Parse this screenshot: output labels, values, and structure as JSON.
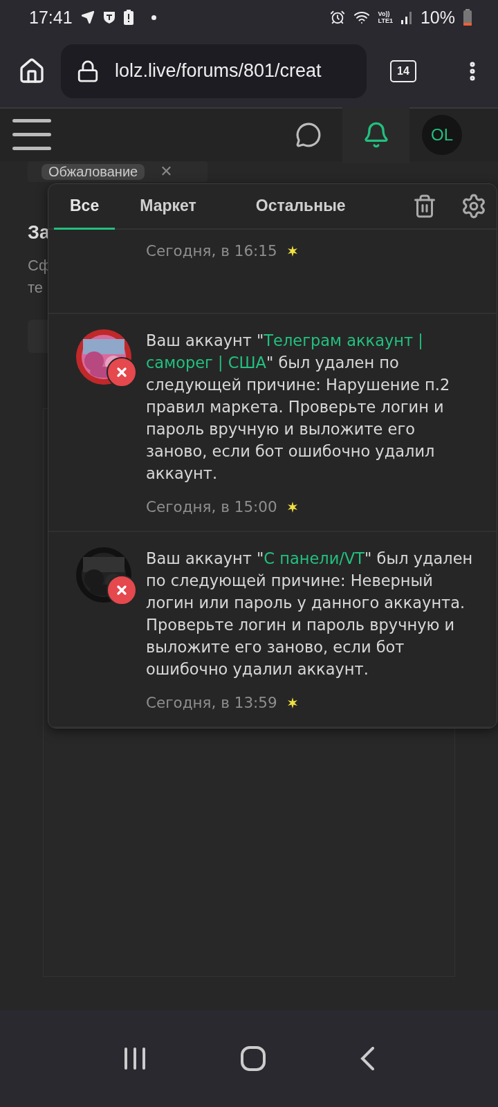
{
  "status_bar": {
    "time": "17:41",
    "network_top": "Vo))",
    "network_bottom": "LTE1",
    "battery": "10%"
  },
  "browser": {
    "url": "lolz.live/forums/801/creat",
    "tab_count": "14"
  },
  "site_header": {
    "avatar_initials": "OL",
    "bell_active": true
  },
  "page": {
    "tag": "Обжалование",
    "tag_remove": "✕",
    "heading": "За",
    "description_lines": [
      "Сф",
      "те"
    ]
  },
  "popup": {
    "tabs": [
      {
        "label": "Все",
        "selected": true
      },
      {
        "label": "Маркет",
        "selected": false
      },
      {
        "label": "Остальные",
        "selected": false
      }
    ],
    "notifications": [
      {
        "time": "Сегодня, в 16:15"
      },
      {
        "kind": "picture",
        "segments": [
          {
            "kind": "plain",
            "text": "Ваш аккаунт \""
          },
          {
            "kind": "link",
            "text": "Телеграм аккаунт |"
          },
          {
            "kind": "link",
            "text": "саморег | США"
          },
          {
            "kind": "plain",
            "text": "\" был удален по следующей причине: Нарушение п.2 правил маркета. Проверьте логин и пароль вручную и выложите его заново, если бот ошибочно удалил аккаунт."
          }
        ],
        "time": "Сегодня, в 15:00"
      },
      {
        "kind": "picture",
        "segments": [
          {
            "kind": "plain",
            "text": "Ваш аккаунт \""
          },
          {
            "kind": "link",
            "text": "С панели/VT"
          },
          {
            "kind": "plain",
            "text": "\" был удален по следующей причине: Неверный логин или пароль у данного аккаунта. Проверьте логин и пароль вручную и выложите его заново, если бот ошибочно удалил аккаунт."
          }
        ],
        "time": "Сегодня, в 13:59"
      }
    ]
  }
}
